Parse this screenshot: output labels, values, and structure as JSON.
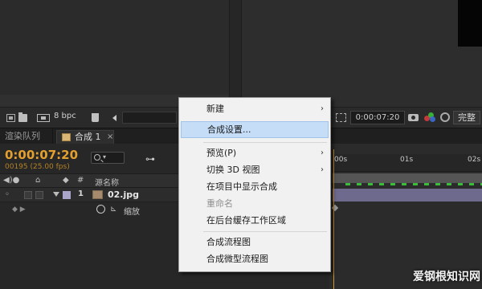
{
  "project_toolbar": {
    "bpc_label": "8 bpc"
  },
  "viewer_toolbar": {
    "timecode": "0:00:07:20",
    "full_label": "完整"
  },
  "tabs": {
    "render_queue": "渲染队列",
    "comp_tab": "合成 1",
    "close_glyph": "×"
  },
  "timeline": {
    "current_time": "0:00:07:20",
    "frame_info": "00195 (25.00 fps)",
    "search_caret": "▾",
    "header": {
      "hash": "#",
      "source_name": "源名称"
    },
    "layer": {
      "number": "1",
      "name": "02.jpg"
    },
    "property": {
      "label": "缩放"
    },
    "ruler": {
      "tick_0": "00s",
      "tick_1": "01s",
      "tick_2": "02s"
    }
  },
  "context_menu": {
    "items": [
      {
        "label": "新建",
        "submenu": true,
        "enabled": true
      },
      {
        "label": "合成设置...",
        "submenu": false,
        "enabled": true,
        "highlighted": true
      },
      {
        "label": "预览(P)",
        "submenu": true,
        "enabled": true
      },
      {
        "label": "切换 3D 视图",
        "submenu": true,
        "enabled": true
      },
      {
        "label": "在项目中显示合成",
        "submenu": false,
        "enabled": true
      },
      {
        "label": "重命名",
        "submenu": false,
        "enabled": false
      },
      {
        "label": "在后台缓存工作区域",
        "submenu": false,
        "enabled": true
      },
      {
        "label": "合成流程图",
        "submenu": false,
        "enabled": true
      },
      {
        "label": "合成微型流程图",
        "submenu": false,
        "enabled": true
      }
    ],
    "arrow_glyph": "›"
  },
  "watermark": "爱钢根知识网",
  "colors": {
    "timecode": "#e3a02e",
    "highlight": "#c5ddf7",
    "layer_label": "#a9a4c9"
  }
}
